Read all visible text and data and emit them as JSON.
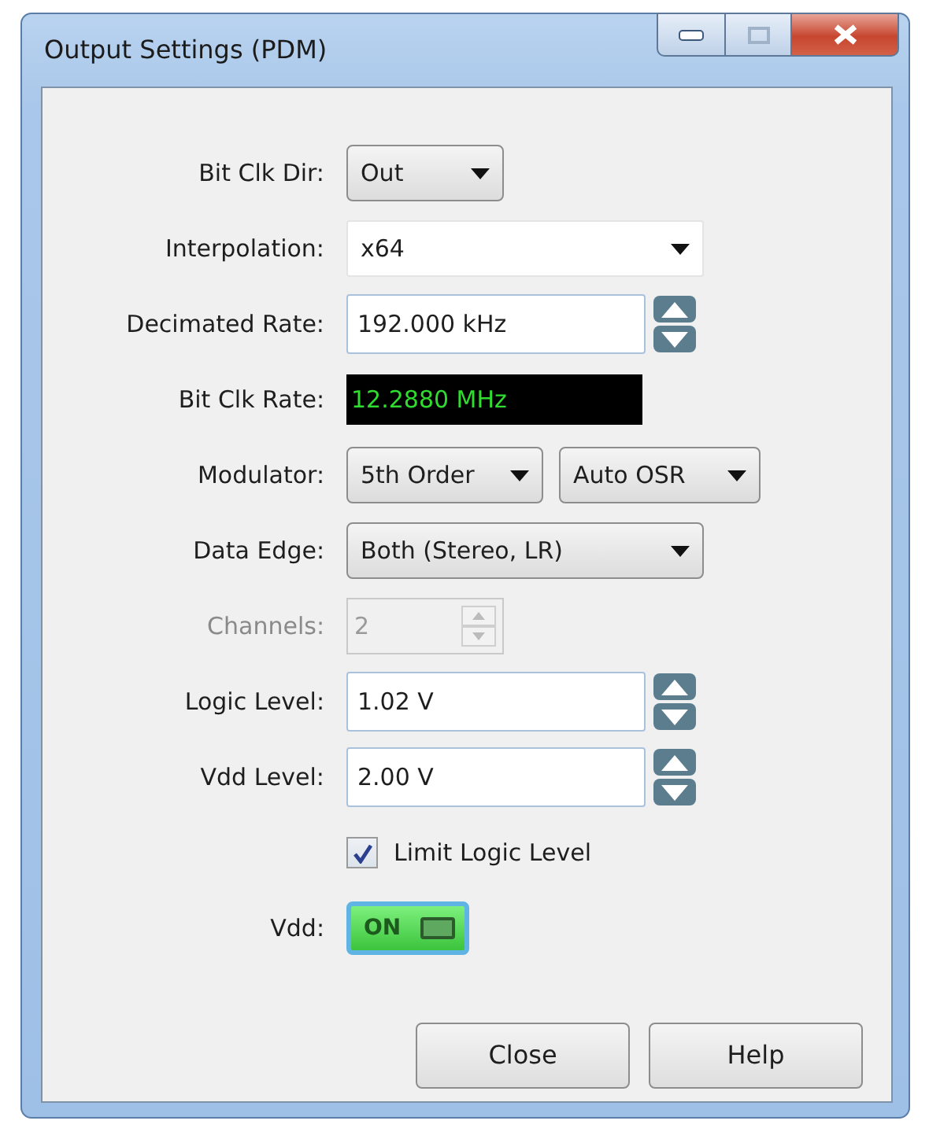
{
  "window": {
    "title": "Output Settings (PDM)"
  },
  "fields": [
    {
      "label": "Bit Clk Dir:",
      "disabled": false,
      "controls": [
        {
          "kind": "dropdown",
          "value": "Out"
        }
      ]
    },
    {
      "label": "Interpolation:",
      "disabled": false,
      "controls": [
        {
          "kind": "combo",
          "value": "x64"
        }
      ]
    },
    {
      "label": "Decimated Rate:",
      "disabled": false,
      "controls": [
        {
          "kind": "spin",
          "value": "192.000 kHz"
        }
      ]
    },
    {
      "label": "Bit Clk Rate:",
      "disabled": false,
      "controls": [
        {
          "kind": "readout",
          "value": "12.2880 MHz"
        }
      ]
    },
    {
      "label": "Modulator:",
      "disabled": false,
      "controls": [
        {
          "kind": "dropdown",
          "value": "5th Order"
        },
        {
          "kind": "dropdown",
          "value": "Auto OSR"
        }
      ]
    },
    {
      "label": "Data Edge:",
      "disabled": false,
      "controls": [
        {
          "kind": "dropdown",
          "value": "Both (Stereo, LR)"
        }
      ]
    },
    {
      "label": "Channels:",
      "disabled": true,
      "controls": [
        {
          "kind": "stepper",
          "value": "2"
        }
      ]
    },
    {
      "label": "Logic Level:",
      "disabled": false,
      "controls": [
        {
          "kind": "spin",
          "value": "1.02 V"
        }
      ]
    },
    {
      "label": "Vdd Level:",
      "disabled": false,
      "controls": [
        {
          "kind": "spin",
          "value": "2.00 V"
        }
      ]
    },
    {
      "disabled": false,
      "controls": [
        {
          "kind": "checkbox",
          "label": "Limit Logic Level",
          "checked": true
        }
      ]
    },
    {
      "label": "Vdd:",
      "disabled": false,
      "controls": [
        {
          "kind": "toggle",
          "text": "ON",
          "on": true
        }
      ]
    }
  ],
  "buttons": [
    "Close",
    "Help"
  ]
}
